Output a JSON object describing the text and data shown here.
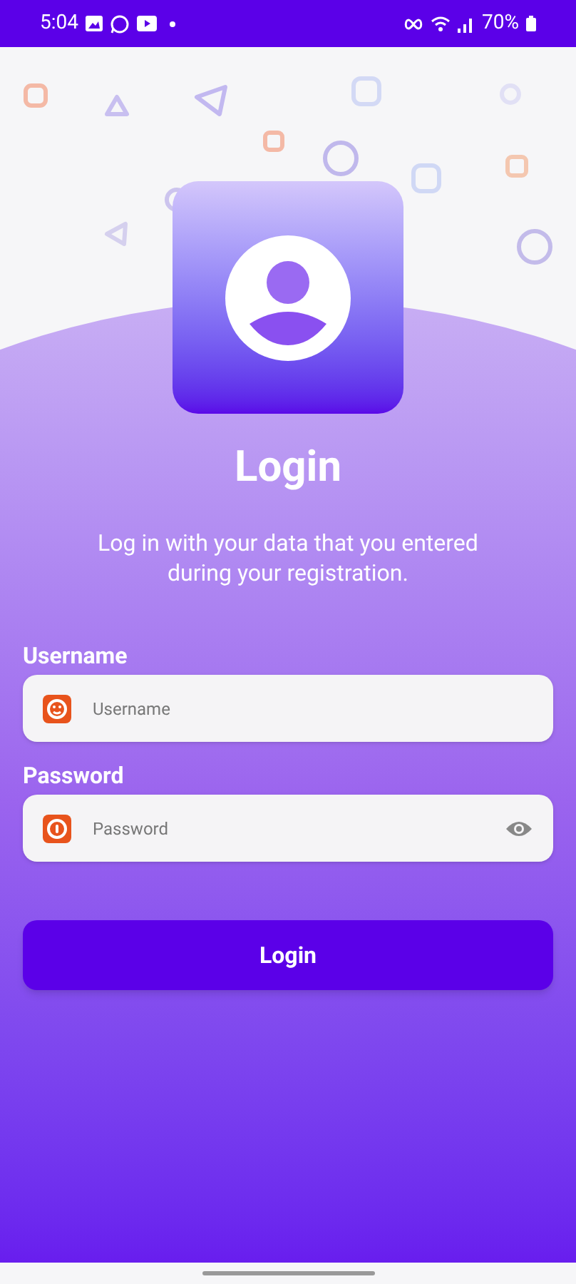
{
  "status_bar": {
    "time": "5:04",
    "battery": "70%"
  },
  "title": "Login",
  "subtitle": "Log in with your data that you entered during your registration.",
  "fields": [
    {
      "label": "Username",
      "placeholder": "Username",
      "kind": "user"
    },
    {
      "label": "Password",
      "placeholder": "Password",
      "kind": "password"
    }
  ],
  "button": "Login"
}
